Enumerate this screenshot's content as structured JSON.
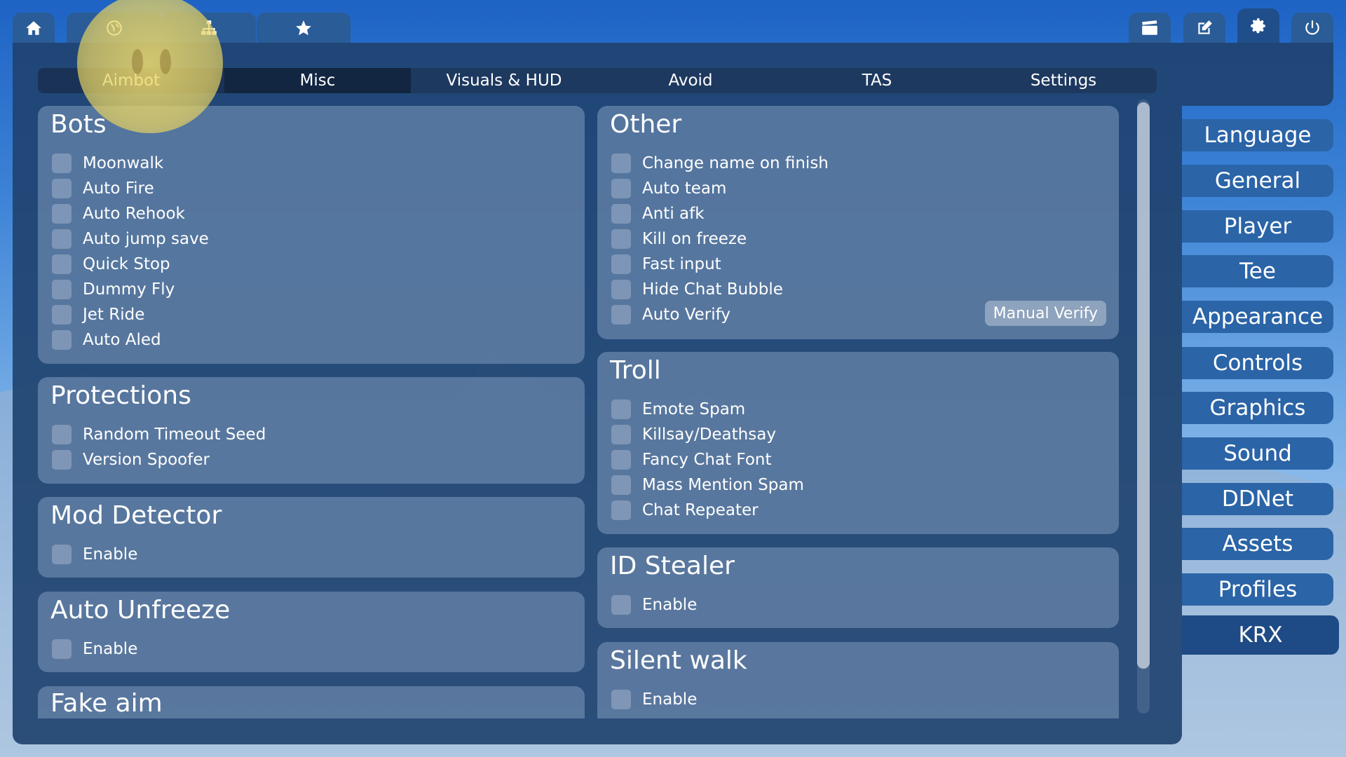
{
  "top_tabs": [
    {
      "icon": "home-icon"
    },
    {
      "icon": "globe-icon"
    },
    {
      "icon": "network-icon"
    },
    {
      "icon": "star-icon"
    },
    {
      "icon": "clapperboard-icon"
    },
    {
      "icon": "edit-icon"
    },
    {
      "icon": "gear-icon"
    },
    {
      "icon": "power-icon"
    }
  ],
  "sub_tabs": [
    "Aimbot",
    "Misc",
    "Visuals & HUD",
    "Avoid",
    "TAS",
    "Settings"
  ],
  "active_sub_tab": "Misc",
  "bots": {
    "title": "Bots",
    "options": [
      "Moonwalk",
      "Auto Fire",
      "Auto Rehook",
      "Auto jump save",
      "Quick Stop",
      "Dummy Fly",
      "Jet Ride",
      "Auto Aled"
    ]
  },
  "protections": {
    "title": "Protections",
    "options": [
      "Random Timeout Seed",
      "Version Spoofer"
    ]
  },
  "mod_detector": {
    "title": "Mod Detector",
    "options": [
      "Enable"
    ]
  },
  "auto_unfreeze": {
    "title": "Auto Unfreeze",
    "options": [
      "Enable"
    ]
  },
  "fake_aim": {
    "title": "Fake aim"
  },
  "other": {
    "title": "Other",
    "options": [
      "Change name on finish",
      "Auto team",
      "Anti afk",
      "Kill on freeze",
      "Fast input",
      "Hide Chat Bubble",
      "Auto Verify"
    ],
    "manual_verify_label": "Manual Verify"
  },
  "troll": {
    "title": "Troll",
    "options": [
      "Emote Spam",
      "Killsay/Deathsay",
      "Fancy Chat Font",
      "Mass Mention Spam",
      "Chat Repeater"
    ]
  },
  "id_stealer": {
    "title": "ID Stealer",
    "options": [
      "Enable"
    ]
  },
  "silent_walk": {
    "title": "Silent walk",
    "options": [
      "Enable"
    ]
  },
  "side_menu": [
    "Language",
    "General",
    "Player",
    "Tee",
    "Appearance",
    "Controls",
    "Graphics",
    "Sound",
    "DDNet",
    "Assets",
    "Profiles",
    "KRX"
  ],
  "active_side_item": "KRX"
}
